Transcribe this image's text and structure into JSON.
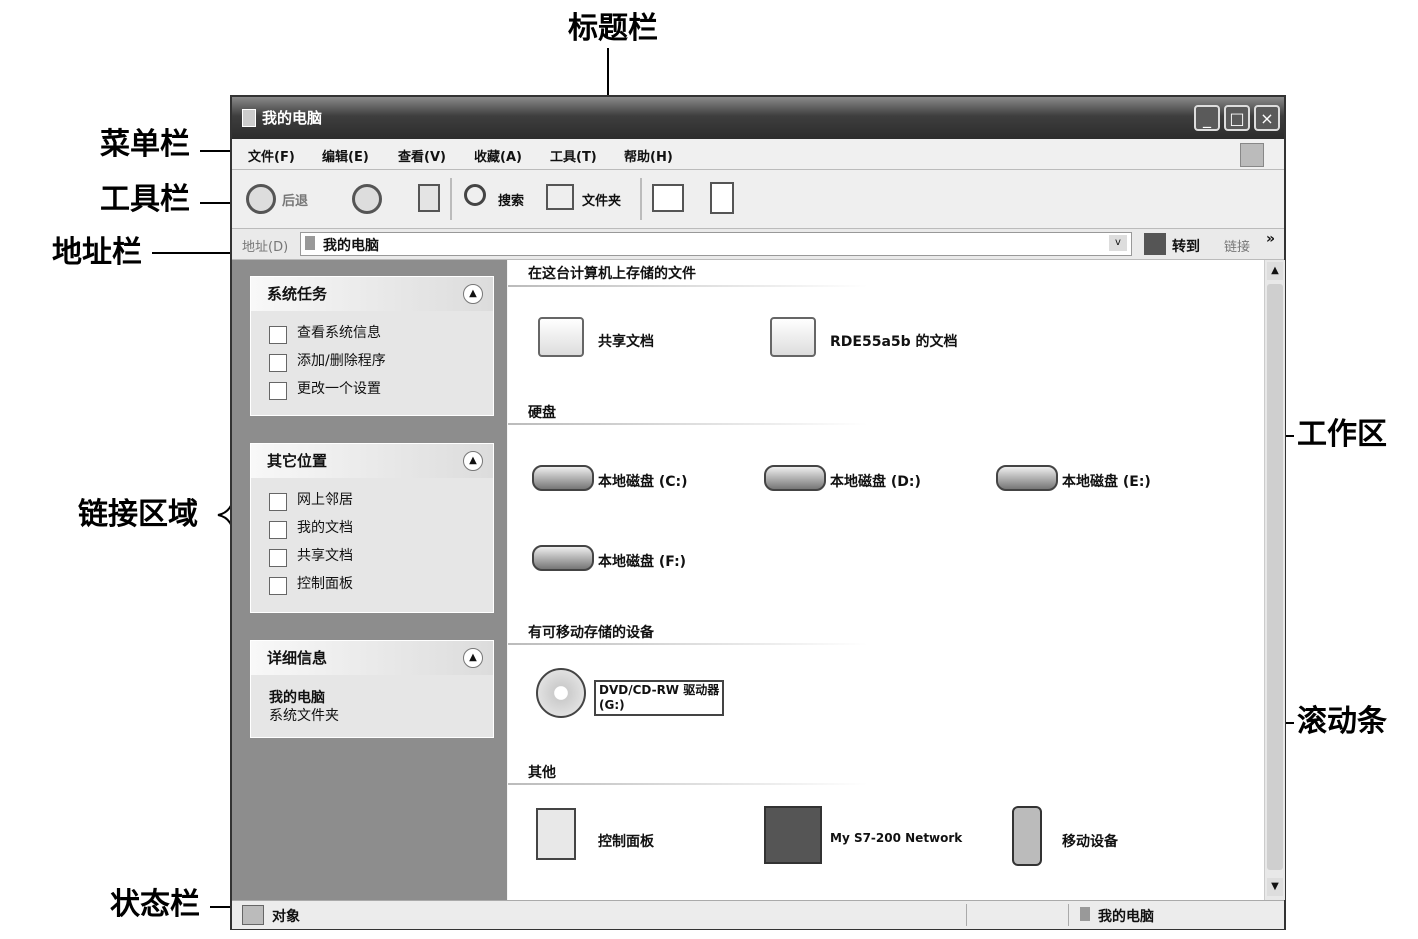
{
  "callouts": {
    "title_bar": "标题栏",
    "menu_bar": "菜单栏",
    "tool_bar": "工具栏",
    "address_bar": "地址栏",
    "link_area": "链接区域",
    "work_area": "工作区",
    "scroll_bar": "滚动条",
    "status_bar": "状态栏"
  },
  "window": {
    "title": "我的电脑",
    "menu": [
      "文件(F)",
      "编辑(E)",
      "查看(V)",
      "收藏(A)",
      "工具(T)",
      "帮助(H)"
    ],
    "toolbar": {
      "back": "后退",
      "search": "搜索",
      "folders": "文件夹"
    },
    "address": {
      "label": "地址(D)",
      "value": "我的电脑",
      "go": "转到",
      "links": "链接"
    }
  },
  "left_pane": {
    "system_tasks": {
      "title": "系统任务",
      "items": [
        "查看系统信息",
        "添加/删除程序",
        "更改一个设置"
      ]
    },
    "other_places": {
      "title": "其它位置",
      "items": [
        "网上邻居",
        "我的文档",
        "共享文档",
        "控制面板"
      ]
    },
    "details": {
      "title": "详细信息",
      "name": "我的电脑",
      "desc": "系统文件夹"
    }
  },
  "content": {
    "sections": {
      "files": "在这台计算机上存储的文件",
      "hard_disks": "硬盘",
      "removable": "有可移动存储的设备",
      "other": "其他"
    },
    "files": [
      "共享文档",
      "RDE55a5b 的文档"
    ],
    "disks": [
      "本地磁盘 (C:)",
      "本地磁盘 (D:)",
      "本地磁盘 (E:)",
      "本地磁盘 (F:)"
    ],
    "removable": [
      "DVD/CD-RW 驱动器",
      "(G:)"
    ],
    "other": [
      "控制面板",
      "My S7-200 Network",
      "移动设备"
    ]
  },
  "status": {
    "objects": "对象",
    "location": "我的电脑"
  }
}
